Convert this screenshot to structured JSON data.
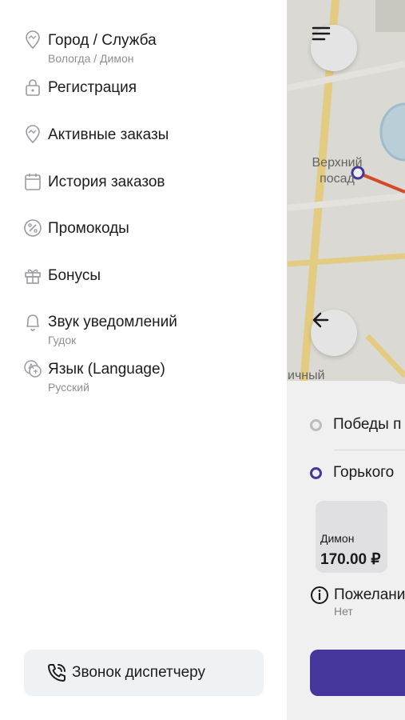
{
  "menu": {
    "items": [
      {
        "id": "city",
        "label": "Город / Служба",
        "sub": "Вологда / Димон",
        "icon": "location-pin-icon"
      },
      {
        "id": "registration",
        "label": "Регистрация",
        "sub": "",
        "icon": "lock-icon"
      },
      {
        "id": "active-orders",
        "label": "Активные заказы",
        "sub": "",
        "icon": "location-pin-icon"
      },
      {
        "id": "order-history",
        "label": "История заказов",
        "sub": "",
        "icon": "calendar-icon"
      },
      {
        "id": "promo",
        "label": "Промокоды",
        "sub": "",
        "icon": "percent-badge-icon"
      },
      {
        "id": "bonus",
        "label": "Бонусы",
        "sub": "",
        "icon": "gift-icon"
      },
      {
        "id": "sound",
        "label": "Звук уведомлений",
        "sub": "Гудок",
        "icon": "bell-icon"
      },
      {
        "id": "language",
        "label": "Язык (Language)",
        "sub": "Русский",
        "icon": "translate-icon"
      }
    ],
    "call_button": {
      "label": "Звонок диспетчеру",
      "icon": "phone-call-icon"
    }
  },
  "background": {
    "map_labels": [
      "Верхний посад",
      "ичный"
    ],
    "route": {
      "from": "Победы п",
      "to": "Горького"
    },
    "tariff": {
      "name": "Димон",
      "price": "170.00 ₽"
    },
    "wishes": {
      "label": "Пожелани",
      "value": "Нет"
    }
  },
  "colors": {
    "accent": "#4a3aa6",
    "route_line": "#e0502a",
    "call_bg": "#eff2f5"
  }
}
